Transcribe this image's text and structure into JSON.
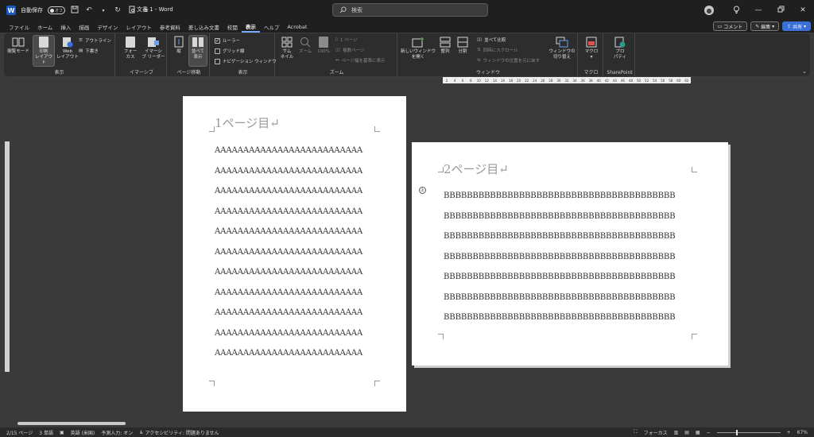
{
  "titlebar": {
    "autosave_label": "自動保存",
    "autosave_state": "オフ",
    "doc_title": "文書 1  -  Word",
    "search_placeholder": "検索"
  },
  "tabs": [
    "ファイル",
    "ホーム",
    "挿入",
    "描画",
    "デザイン",
    "レイアウト",
    "参考資料",
    "差し込み文書",
    "校閲",
    "表示",
    "ヘルプ",
    "Acrobat"
  ],
  "active_tab": "表示",
  "tab_actions": {
    "comment": "コメント",
    "edit": "編集",
    "share": "共有"
  },
  "ribbon": {
    "groups": {
      "view": "表示",
      "immersive": "イマーシブ",
      "page_move": "ページ移動",
      "show": "表示",
      "zoom": "ズーム",
      "window": "ウィンドウ",
      "macro": "マクロ",
      "sharepoint": "SharePoint"
    },
    "view": {
      "read_mode": "閲覧モード",
      "print_layout_1": "印刷",
      "print_layout_2": "レイアウト",
      "web_layout_1": "Web",
      "web_layout_2": "レイアウト",
      "outline": "アウトライン",
      "draft": "下書き"
    },
    "immersive": {
      "focus_1": "フォー",
      "focus_2": "カス",
      "reader_1": "イマーシ",
      "reader_2": "ブ リーダー"
    },
    "page_move": {
      "vertical": "縦",
      "side_1": "並べて",
      "side_2": "表示"
    },
    "show": {
      "ruler": "ルーラー",
      "gridlines": "グリッド線",
      "navigation": "ナビゲーション ウィンドウ"
    },
    "zoom": {
      "thumbnail_1": "サム",
      "thumbnail_2": "ネイル",
      "zoom": "ズーム",
      "percent": "100%",
      "one_page": "1 ページ",
      "multi_page": "複数ページ",
      "page_width": "ページ幅を基準に表示"
    },
    "window": {
      "new_window_1": "新しいウィンドウ",
      "new_window_2": "を開く",
      "arrange": "整列",
      "split": "分割",
      "side_by_side": "並べて比較",
      "sync_scroll": "同時にスクロール",
      "reset_position": "ウィンドウの位置を元に戻す",
      "switch_1": "ウィンドウの",
      "switch_2": "切り替え"
    },
    "macro": {
      "macro": "マクロ"
    },
    "sharepoint": {
      "properties_1": "プロ",
      "properties_2": "パティ"
    }
  },
  "ruler_numbers": [
    "2",
    "4",
    "6",
    "8",
    "10",
    "12",
    "14",
    "16",
    "18",
    "20",
    "22",
    "24",
    "26",
    "28",
    "30",
    "32",
    "34",
    "36",
    "38",
    "40",
    "42",
    "44",
    "46",
    "48",
    "50",
    "52",
    "54",
    "56",
    "58",
    "60",
    "62"
  ],
  "document": {
    "page1": {
      "heading": "1ページ目↵",
      "lines": [
        "AAAAAAAAAAAAAAAAAAAAAAAAAA",
        "AAAAAAAAAAAAAAAAAAAAAAAAAA",
        "AAAAAAAAAAAAAAAAAAAAAAAAAA",
        "AAAAAAAAAAAAAAAAAAAAAAAAAA",
        "AAAAAAAAAAAAAAAAAAAAAAAAAA",
        "AAAAAAAAAAAAAAAAAAAAAAAAAA",
        "AAAAAAAAAAAAAAAAAAAAAAAAAA",
        "AAAAAAAAAAAAAAAAAAAAAAAAAA",
        "AAAAAAAAAAAAAAAAAAAAAAAAAA",
        "AAAAAAAAAAAAAAAAAAAAAAAAAA",
        "AAAAAAAAAAAAAAAAAAAAAAAAAA"
      ]
    },
    "page2": {
      "heading": "2ページ目↵",
      "lines": [
        "BBBBBBBBBBBBBBBBBBBBBBBBBBBBBBBBBBBBBBBB",
        "BBBBBBBBBBBBBBBBBBBBBBBBBBBBBBBBBBBBBBBB",
        "BBBBBBBBBBBBBBBBBBBBBBBBBBBBBBBBBBBBBBBB",
        "BBBBBBBBBBBBBBBBBBBBBBBBBBBBBBBBBBBBBBBB",
        "BBBBBBBBBBBBBBBBBBBBBBBBBBBBBBBBBBBBBBBB",
        "BBBBBBBBBBBBBBBBBBBBBBBBBBBBBBBBBBBBBBBB",
        "BBBBBBBBBBBBBBBBBBBBBBBBBBBBBBBBBBBBBBBB"
      ]
    }
  },
  "statusbar": {
    "page": "2/15 ページ",
    "words": "3 単語",
    "language": "英語 (米国)",
    "predict": "予測入力: オン",
    "accessibility": "アクセシビリティ: 問題ありません",
    "focus": "フォーカス",
    "zoom_value": 67,
    "zoom": "67%"
  },
  "colors": {
    "accent": "#79a8ff",
    "share": "#3a6fd8",
    "word_blue": "#185abd",
    "canvas": "#3a3a3a"
  }
}
